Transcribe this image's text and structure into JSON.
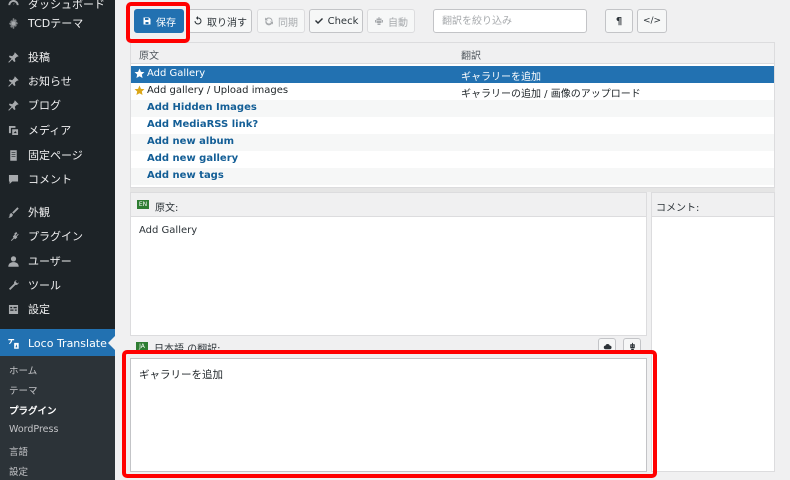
{
  "sidebar": {
    "items": [
      {
        "id": "dashboard",
        "label": "ダッシュボード",
        "icon": "dashboard-icon"
      },
      {
        "id": "tcd",
        "label": "TCDテーマ",
        "icon": "gear-icon"
      },
      {
        "id": "posts",
        "label": "投稿",
        "icon": "pin-icon"
      },
      {
        "id": "news",
        "label": "お知らせ",
        "icon": "pin-icon"
      },
      {
        "id": "blog",
        "label": "ブログ",
        "icon": "pin-icon"
      },
      {
        "id": "media",
        "label": "メディア",
        "icon": "media-icon"
      },
      {
        "id": "pages",
        "label": "固定ページ",
        "icon": "page-icon"
      },
      {
        "id": "comments",
        "label": "コメント",
        "icon": "comment-icon"
      },
      {
        "id": "appearance",
        "label": "外観",
        "icon": "brush-icon"
      },
      {
        "id": "plugins",
        "label": "プラグイン",
        "icon": "plugin-icon"
      },
      {
        "id": "users",
        "label": "ユーザー",
        "icon": "user-icon"
      },
      {
        "id": "tools",
        "label": "ツール",
        "icon": "wrench-icon"
      },
      {
        "id": "settings",
        "label": "設定",
        "icon": "settings-icon"
      }
    ],
    "loco": {
      "label": "Loco Translate",
      "icon": "translate-icon"
    },
    "submenu": [
      "ホーム",
      "テーマ",
      "プラグイン",
      "WordPress",
      "言語",
      "設定"
    ],
    "active_submenu": "プラグイン"
  },
  "toolbar": {
    "save": "保存",
    "revert": "取り消す",
    "sync": "同期",
    "check": "Check",
    "auto": "自動",
    "filter_placeholder": "翻訳を絞り込み",
    "pilcrow": "¶",
    "code": "</>"
  },
  "list": {
    "col_source": "原文",
    "col_target": "翻訳",
    "rows": [
      {
        "source": "Add Gallery",
        "target": "ギャラリーを追加",
        "starred": true,
        "selected": true
      },
      {
        "source": "Add gallery / Upload images",
        "target": "ギャラリーの追加 / 画像のアップロード",
        "starred": true,
        "selected": false
      },
      {
        "source": "Add Hidden Images",
        "target": "",
        "starred": false,
        "selected": false
      },
      {
        "source": "Add MediaRSS link?",
        "target": "",
        "starred": false,
        "selected": false
      },
      {
        "source": "Add new album",
        "target": "",
        "starred": false,
        "selected": false
      },
      {
        "source": "Add new gallery",
        "target": "",
        "starred": false,
        "selected": false
      },
      {
        "source": "Add new tags",
        "target": "",
        "starred": false,
        "selected": false
      }
    ]
  },
  "source_pane": {
    "lang_code": "EN",
    "label": "原文:",
    "text": "Add Gallery"
  },
  "comment_pane": {
    "label": "コメント:"
  },
  "target_pane": {
    "lang_code": "JA",
    "label": "日本語 の翻訳:",
    "value": "ギャラリーを追加"
  },
  "colors": {
    "accent": "#2271b1",
    "highlight": "#ff0000",
    "sidebar": "#1d2327"
  }
}
